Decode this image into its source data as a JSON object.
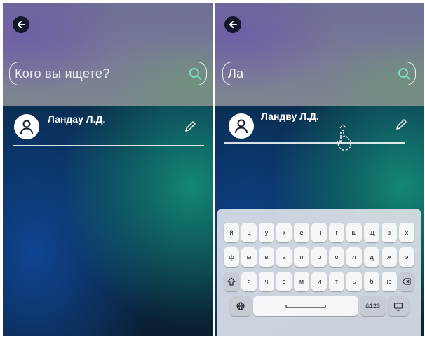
{
  "left_screen": {
    "search": {
      "placeholder": "Кого вы ищете?"
    },
    "contacts": [
      {
        "name": "Ландау Л.Д."
      }
    ]
  },
  "right_screen": {
    "search": {
      "value": "Ла"
    },
    "contacts": [
      {
        "name": "Ландву Л.Д."
      }
    ]
  },
  "keyboard": {
    "rows": [
      [
        "й",
        "ц",
        "у",
        "к",
        "е",
        "н",
        "г",
        "ш",
        "щ",
        "з",
        "х"
      ],
      [
        "ф",
        "ы",
        "в",
        "а",
        "п",
        "р",
        "о",
        "л",
        "д",
        "ж",
        "э"
      ],
      [
        "я",
        "ч",
        "с",
        "м",
        "и",
        "т",
        "ь",
        "б",
        "ю"
      ]
    ],
    "num_label": "&123"
  },
  "icons": {
    "back": "arrow-left-icon",
    "search": "search-icon",
    "avatar": "person-icon",
    "edit": "pencil-icon",
    "shift": "shift-icon",
    "backspace": "backspace-icon",
    "globe": "globe-icon",
    "keyboard_hide": "keyboard-icon",
    "tap": "hand-pointer-icon"
  }
}
